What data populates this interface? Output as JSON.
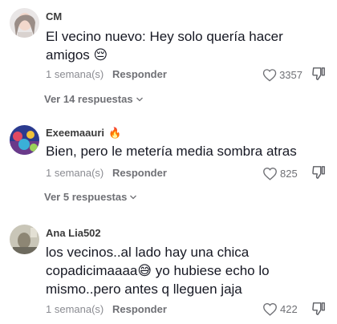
{
  "comments": [
    {
      "username": "CM",
      "badge": "",
      "text": "El vecino nuevo: Hey solo quería hacer amigos 😔",
      "time": "1 semana(s)",
      "reply_label": "Responder",
      "likes": "3357",
      "replies_label": "Ver 14 respuestas"
    },
    {
      "username": "Exeemaauri",
      "badge": "🔥",
      "text": "Bien, pero le metería media sombra atras",
      "time": "1 semana(s)",
      "reply_label": "Responder",
      "likes": "825",
      "replies_label": "Ver 5 respuestas"
    },
    {
      "username": "Ana Lia502",
      "badge": "",
      "text": "los vecinos..al lado hay una chica copadicimaaaa😅 yo hubiese echo lo mismo..pero antes q lleguen jaja",
      "time": "1 semana(s)",
      "reply_label": "Responder",
      "likes": "422",
      "replies_label": ""
    }
  ],
  "icons": {
    "like": "heart-outline-icon",
    "dislike": "thumbs-down-icon",
    "expand": "chevron-down-icon"
  }
}
